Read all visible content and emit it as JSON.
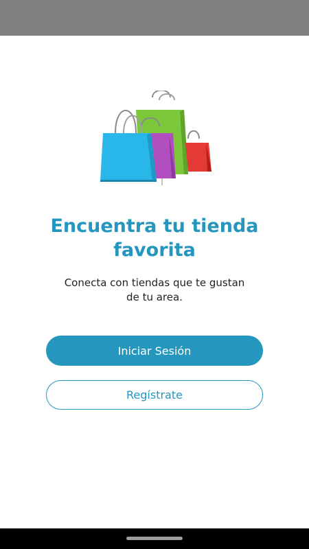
{
  "status_bar": {},
  "hero": {
    "icon": "shopping-bags-icon",
    "colors": {
      "blue_bag": "#29b6e8",
      "green_bag": "#7cc83a",
      "purple_bag": "#b24fc0",
      "red_bag": "#e53935"
    }
  },
  "main": {
    "title_line1": "Encuentra tu tienda",
    "title_line2": "favorita",
    "subtitle_line1": "Conecta con tiendas que te gustan",
    "subtitle_line2": "de tu area."
  },
  "actions": {
    "login_label": "Iniciar Sesión",
    "register_label": "Regístrate"
  },
  "theme": {
    "accent": "#2596be",
    "status_bar": "#808080",
    "nav_bar": "#000000"
  }
}
